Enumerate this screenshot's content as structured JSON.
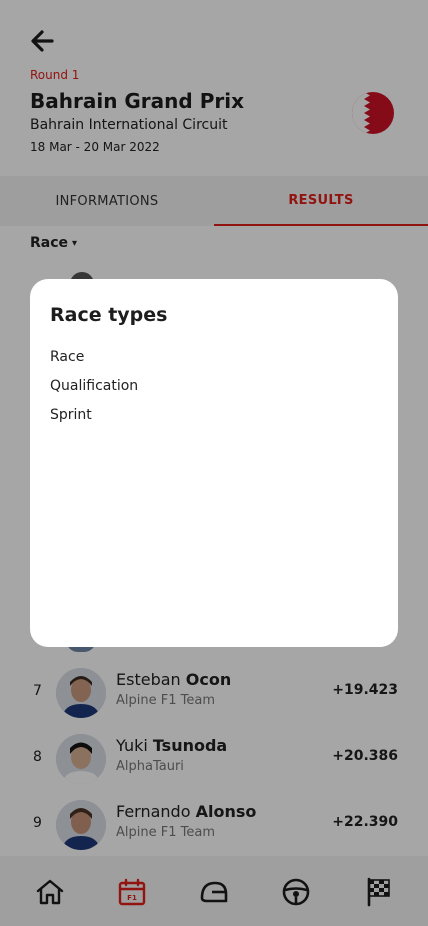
{
  "header": {
    "round_label": "Round 1",
    "title": "Bahrain Grand Prix",
    "circuit": "Bahrain International Circuit",
    "dates": "18 Mar - 20 Mar 2022",
    "flag_icon": "bahrain-flag-icon",
    "flag_colors": [
      "#ce1126",
      "#ffffff"
    ]
  },
  "tabs": [
    {
      "label": "INFORMATIONS",
      "active": false
    },
    {
      "label": "RESULTS",
      "active": true
    }
  ],
  "race_select": {
    "label": "Race",
    "caret": "▾"
  },
  "results": [
    {
      "position": "7",
      "first_name": "Esteban",
      "last_name": "Ocon",
      "team": "Alpine F1 Team",
      "gap": "+19.423"
    },
    {
      "position": "8",
      "first_name": "Yuki",
      "last_name": "Tsunoda",
      "team": "AlphaTauri",
      "gap": "+20.386"
    },
    {
      "position": "9",
      "first_name": "Fernando",
      "last_name": "Alonso",
      "team": "Alpine F1 Team",
      "gap": "+22.390"
    }
  ],
  "modal": {
    "title": "Race types",
    "options": [
      "Race",
      "Qualification",
      "Sprint"
    ]
  },
  "bottom_nav": [
    {
      "icon": "home-icon",
      "active": false
    },
    {
      "icon": "calendar-f1-icon",
      "active": true
    },
    {
      "icon": "helmet-icon",
      "active": false
    },
    {
      "icon": "steering-wheel-icon",
      "active": false
    },
    {
      "icon": "checkered-flag-icon",
      "active": false
    }
  ],
  "colors": {
    "accent": "#e0201b",
    "overlay": "rgba(0,0,0,0.35)"
  }
}
